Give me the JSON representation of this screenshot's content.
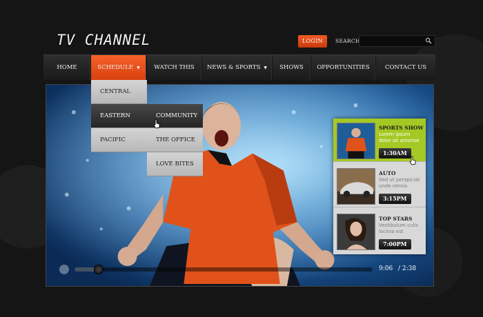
{
  "header": {
    "logo": "TV CHANNEL",
    "login_label": "LOGIN",
    "search_label": "SEARCH",
    "search_value": ""
  },
  "nav": {
    "items": [
      {
        "label": "HOME"
      },
      {
        "label": "SCHEDULE",
        "dropdown": true,
        "active": true
      },
      {
        "label": "WATCH THIS"
      },
      {
        "label": "NEWS & SPORTS",
        "dropdown": true
      },
      {
        "label": "SHOWS"
      },
      {
        "label": "OPPORTUNITIES"
      },
      {
        "label": "CONTACT US"
      }
    ]
  },
  "schedule_menu": {
    "items": [
      {
        "label": "CENTRAL"
      },
      {
        "label": "EASTERN",
        "highlighted": true
      },
      {
        "label": "PACIFIC"
      }
    ]
  },
  "eastern_submenu": {
    "items": [
      {
        "label": "COMMUNITY",
        "highlighted": true
      },
      {
        "label": "THE OFFICE"
      },
      {
        "label": "LOVE BITES"
      }
    ]
  },
  "side_panel": {
    "items": [
      {
        "title": "SPORTS SHOW",
        "desc": "Lorem ipsum dolor sit amonse",
        "time": "1:30AM",
        "active": true
      },
      {
        "title": "AUTO",
        "desc": "Sed ut perspiciat unde omnis",
        "time": "3:15PM"
      },
      {
        "title": "TOP STARS",
        "desc": "Vestibulum culis lacinia est",
        "time": "7:00PM"
      }
    ]
  },
  "player": {
    "current_time": "9:06",
    "total_time": "/ 2:38",
    "progress": 0.08
  },
  "colors": {
    "accent": "#e24a16",
    "active_item": "#a5c924",
    "background": "#151515"
  }
}
